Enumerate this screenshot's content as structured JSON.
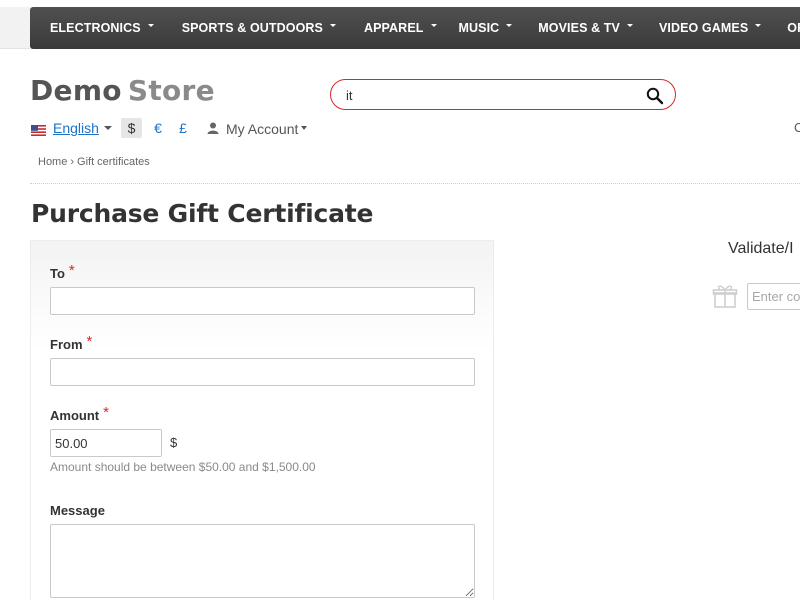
{
  "nav": {
    "items": [
      {
        "label": "ELECTRONICS"
      },
      {
        "label": "SPORTS & OUTDOORS"
      },
      {
        "label": "APPAREL"
      },
      {
        "label": "MUSIC"
      },
      {
        "label": "MOVIES & TV"
      },
      {
        "label": "VIDEO GAMES"
      },
      {
        "label": "OFFICE SUP"
      }
    ]
  },
  "header": {
    "logo_part1": "Demo",
    "logo_part2": "Store",
    "search": {
      "value": "it",
      "icon": "search-icon"
    },
    "language": "English",
    "currencies": {
      "usd": "$",
      "eur": "€",
      "gbp": "£",
      "selected": "usd"
    },
    "account_label": "My Account",
    "edge_glyph": "C"
  },
  "breadcrumb": {
    "home": "Home",
    "separator": "›",
    "current": "Gift certificates"
  },
  "page": {
    "title": "Purchase Gift Certificate"
  },
  "form": {
    "to_label": "To",
    "from_label": "From",
    "amount_label": "Amount",
    "required_marker": "*",
    "to_value": "",
    "from_value": "",
    "amount_value": "50.00",
    "amount_currency": "$",
    "amount_hint": "Amount should be between $50.00 and $1,500.00",
    "message_label": "Message",
    "message_value": ""
  },
  "sidebar": {
    "validate_title": "Validate/I",
    "code_placeholder": "Enter co",
    "gift_icon": "gift-icon"
  },
  "colors": {
    "nav_bg": "#454545",
    "accent_red": "#d9262b",
    "link_blue": "#1a73c9",
    "required": "#d9262b"
  }
}
